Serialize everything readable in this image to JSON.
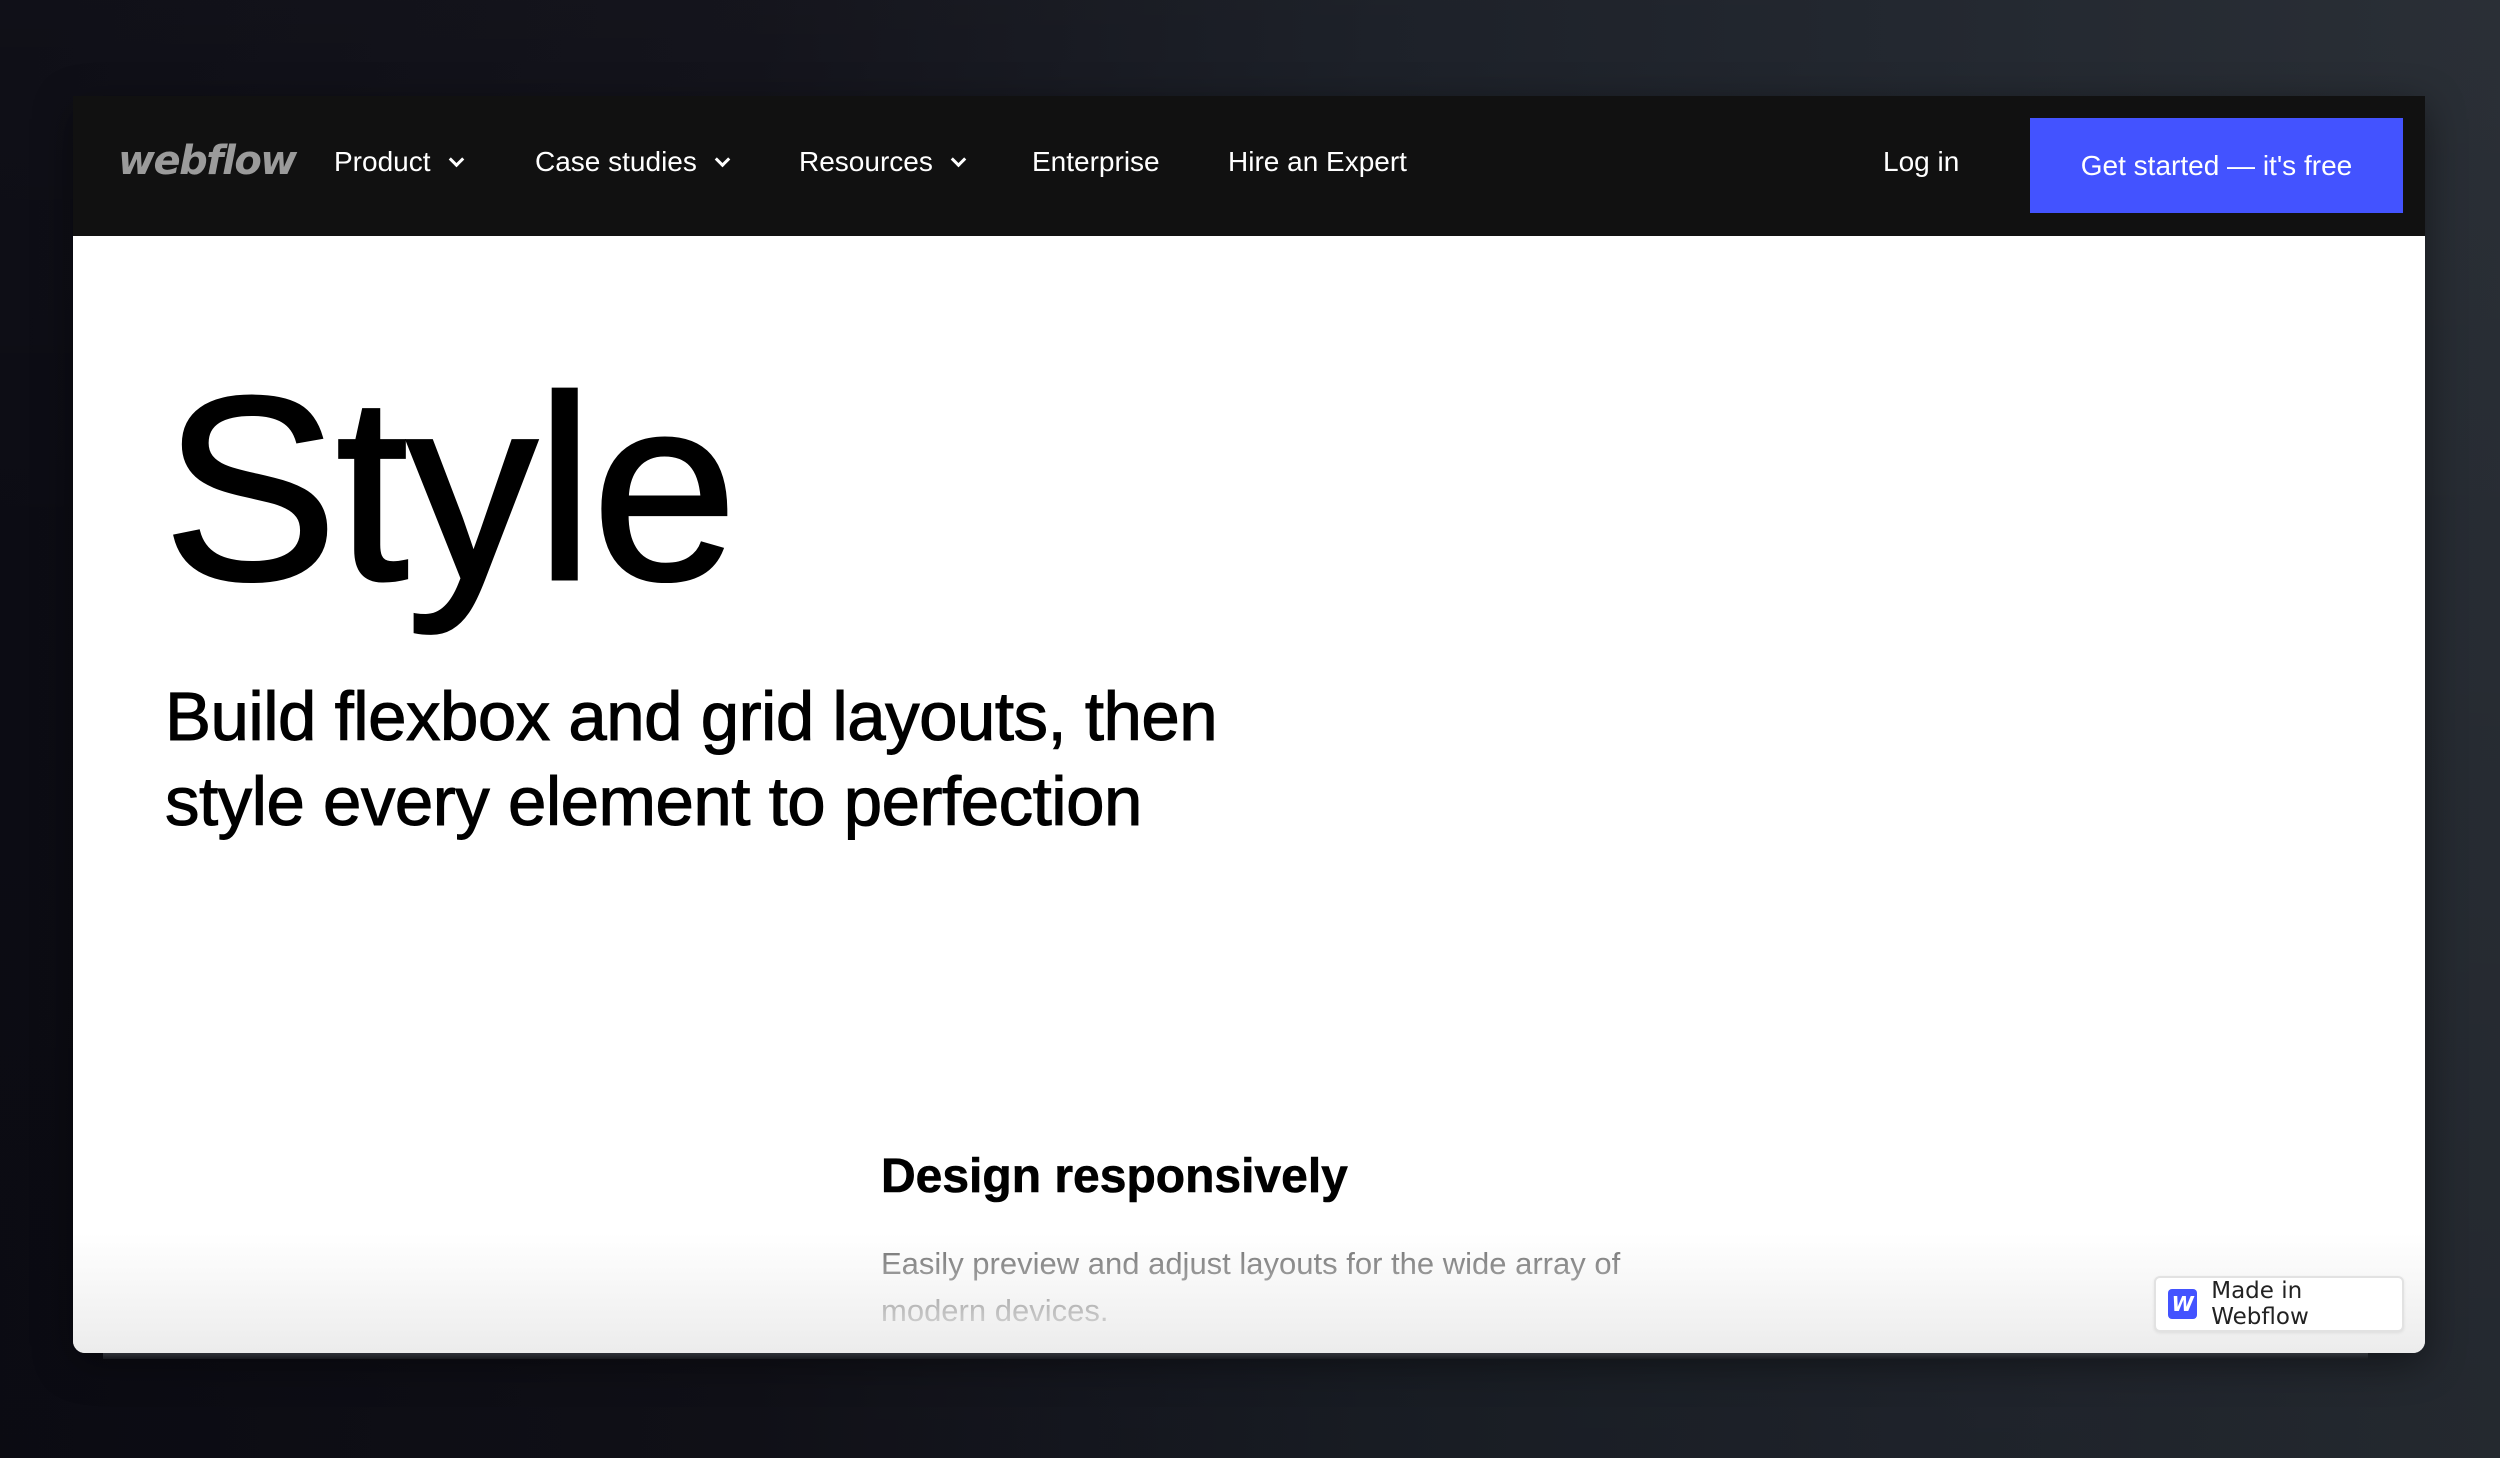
{
  "nav": {
    "logo": "webflow",
    "items": [
      {
        "label": "Product",
        "has_dropdown": true
      },
      {
        "label": "Case studies",
        "has_dropdown": true
      },
      {
        "label": "Resources",
        "has_dropdown": true
      },
      {
        "label": "Enterprise",
        "has_dropdown": false
      },
      {
        "label": "Hire an Expert",
        "has_dropdown": false
      }
    ],
    "login_label": "Log in",
    "cta_label": "Get started — it's free"
  },
  "hero": {
    "title": "Style",
    "subtitle": "Build flexbox and grid layouts, then style every element to perfection"
  },
  "feature": {
    "heading": "Design responsively",
    "body": "Easily preview and adjust layouts for the wide array of modern devices."
  },
  "badge": {
    "icon_letter": "W",
    "label": "Made in Webflow"
  },
  "colors": {
    "brand_blue": "#4353ff",
    "nav_background": "#111111",
    "logo_grey": "#9b9b9b",
    "body_grey": "#6b6b6b"
  },
  "icons": {
    "dropdown": "chevron-down-icon",
    "badge": "webflow-logo-icon"
  }
}
